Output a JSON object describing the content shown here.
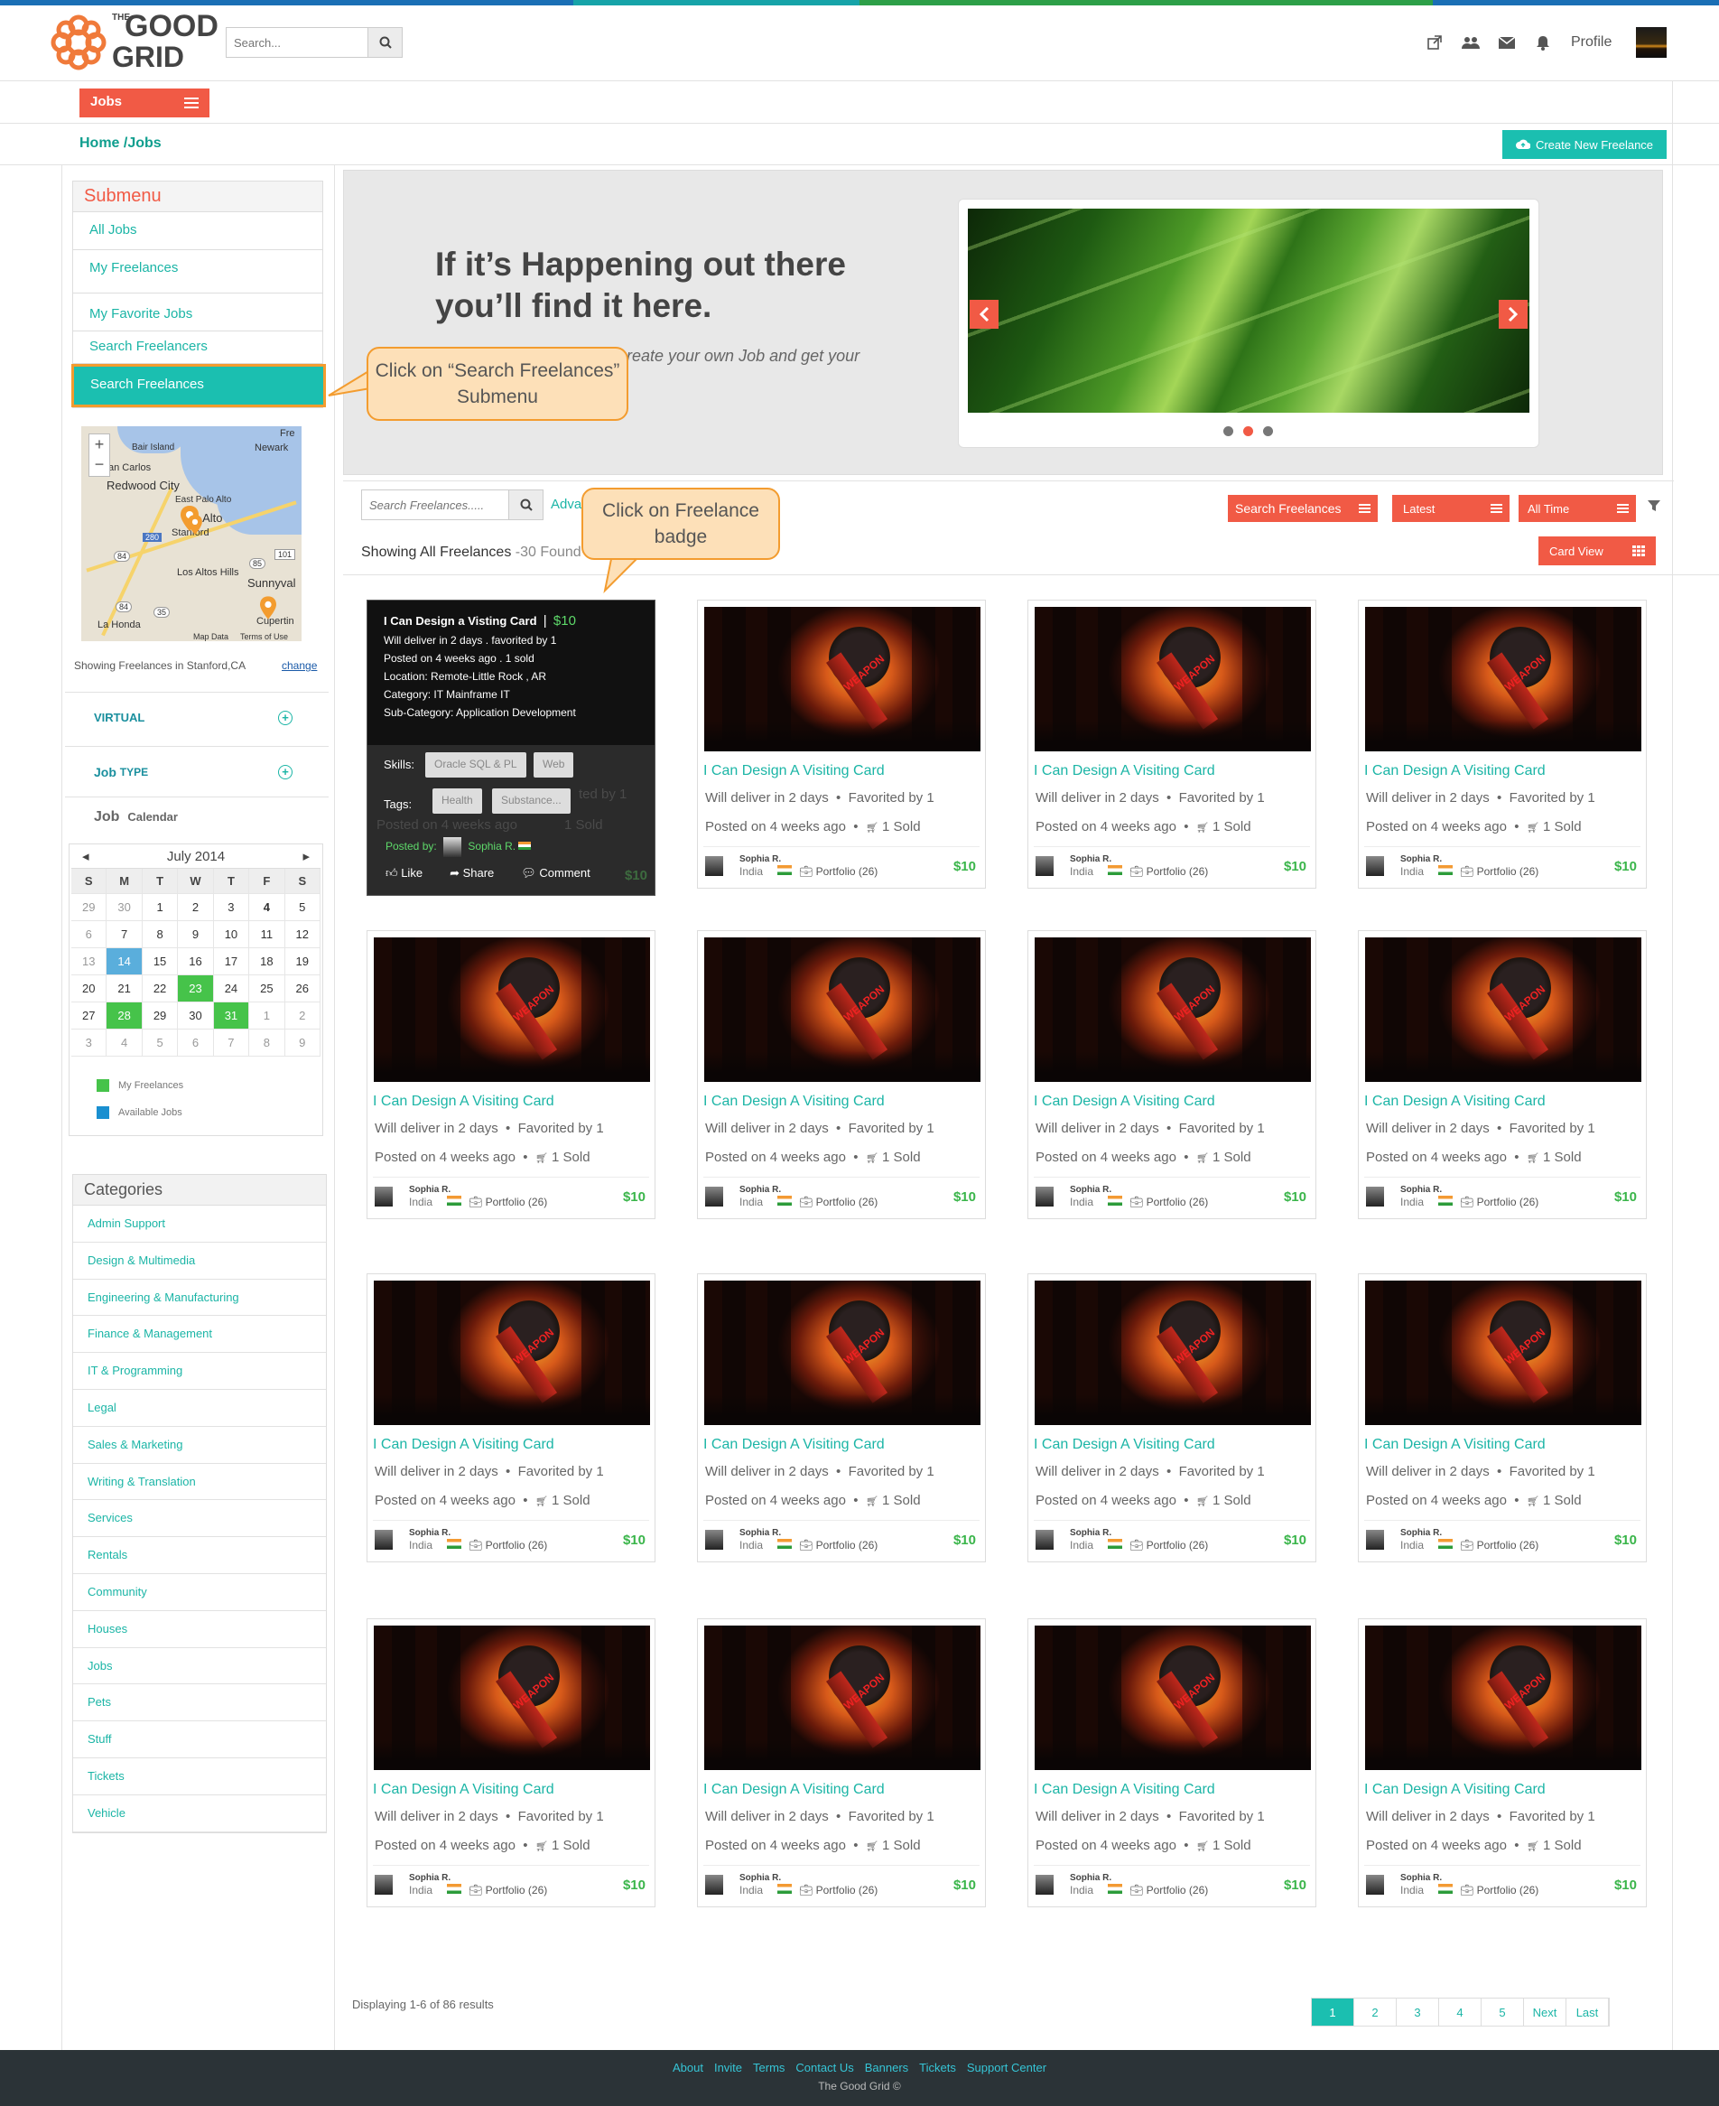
{
  "brand": {
    "logo_line1": "THE",
    "logo_line2": "GOOD",
    "logo_line3": "GRID",
    "accent": "#f15a45",
    "teal": "#1bbfb0"
  },
  "header": {
    "search_placeholder": "Search...",
    "profile_label": "Profile"
  },
  "nav": {
    "jobs_label": "Jobs"
  },
  "breadcrumb": "Home /Jobs",
  "create_button": "Create New Freelance",
  "submenu": {
    "title": "Submenu",
    "items": [
      "All Jobs",
      "My Freelances",
      "My Favorite Jobs",
      "Search Freelancers",
      "Search Freelances"
    ]
  },
  "map": {
    "labels": [
      "Fre",
      "Newark",
      "Bair Island",
      "an Carlos",
      "Redwood City",
      "East Palo Alto",
      "o Alto",
      "Stanford",
      "Los Altos Hills",
      "Sunnyval",
      "La Honda",
      "Cupertin",
      "Map Data",
      "Terms of Use"
    ],
    "roads": [
      "84",
      "280",
      "101",
      "85",
      "84",
      "35"
    ],
    "zoom_in": "+",
    "zoom_out": "−"
  },
  "location": {
    "text": "Showing Freelances in Stanford,CA",
    "change": "change"
  },
  "filters": {
    "virtual": "VIRTUAL",
    "job_type_a": "Job",
    "job_type_b": "TYPE",
    "calendar_a": "Job",
    "calendar_b": "Calendar"
  },
  "calendar": {
    "month": "July 2014",
    "prev": "◂",
    "next": "▸",
    "days_of_week": [
      "S",
      "M",
      "T",
      "W",
      "T",
      "F",
      "S"
    ],
    "weeks": [
      [
        "29",
        "30",
        "1",
        "2",
        "3",
        "4",
        "5"
      ],
      [
        "6",
        "7",
        "8",
        "9",
        "10",
        "11",
        "12"
      ],
      [
        "13",
        "14",
        "15",
        "16",
        "17",
        "18",
        "19"
      ],
      [
        "20",
        "21",
        "22",
        "23",
        "24",
        "25",
        "26"
      ],
      [
        "27",
        "28",
        "29",
        "30",
        "31",
        "1",
        "2"
      ],
      [
        "3",
        "4",
        "5",
        "6",
        "7",
        "8",
        "9"
      ]
    ],
    "legend_my": "My Freelances",
    "legend_available": "Available Jobs",
    "green_color": "#46c34a",
    "blue_color": "#5aaedc"
  },
  "categories": {
    "title": "Categories",
    "items": [
      "Admin Support",
      "Design & Multimedia",
      "Engineering & Manufacturing",
      "Finance & Management",
      "IT & Programming",
      "Legal",
      "Sales & Marketing",
      "Writing & Translation",
      "Services",
      "Rentals",
      "Community",
      "Houses",
      "Jobs",
      "Pets",
      "Stuff",
      "Tickets",
      "Vehicle"
    ]
  },
  "banner": {
    "headline_1": "If it’s Happening out there",
    "headline_2": "you’ll find it here.",
    "sub": "reate your own Job and get your"
  },
  "toolbar": {
    "search_placeholder": "Search Freelances.....",
    "advanced": "Adva",
    "search_btn": "Search Freelances",
    "sort_btn": "Latest",
    "time_btn": "All Time",
    "showing": "Showing All Freelances",
    "count": " -30 Found",
    "card_view": "Card View"
  },
  "hover_card": {
    "title": "I Can Design a Visting Card",
    "sep": "|",
    "price": "$10",
    "line1": "Will deliver in 2 days . favorited by 1",
    "line2": "Posted on 4 weeks ago . 1 sold",
    "line3": "Location: Remote-Little Rock , AR",
    "line4": "Category: IT Mainframe IT",
    "line5": "Sub-Category: Application Development",
    "skills_label": "Skills:",
    "skills": [
      "Oracle SQL & PL",
      "Web"
    ],
    "tags_label": "Tags:",
    "tags": [
      "Health",
      "Substance..."
    ],
    "posted_by": "Posted by:",
    "author": "Sophia R.",
    "like": "Like",
    "share": "Share",
    "comment": "Comment",
    "ghost_1": "ted by 1",
    "ghost_2": "Posted on 4 weeks ago",
    "ghost_3": "1 Sold"
  },
  "card": {
    "title": "I Can Design A Visiting Card",
    "deliver": "Will deliver in 2 days",
    "favorited": "Favorited by 1",
    "posted": "Posted on 4 weeks ago",
    "sold": "1 Sold",
    "author": "Sophia R.",
    "country": "India",
    "portfolio": "Portfolio (26)",
    "price": "$10",
    "image_caption": "WEAPON"
  },
  "pagination": {
    "display": "Displaying 1-6 of 86 results",
    "pages": [
      "1",
      "2",
      "3",
      "4",
      "5",
      "Next",
      "Last"
    ]
  },
  "footer": {
    "links": [
      "About",
      "Invite",
      "Terms",
      "Contact Us",
      "Banners",
      "Tickets",
      "Support Center"
    ],
    "copyright": "The Good Grid ©"
  },
  "callouts": {
    "submenu": "Click on “Search Freelances” Submenu",
    "badge": "Click on Freelance badge"
  }
}
